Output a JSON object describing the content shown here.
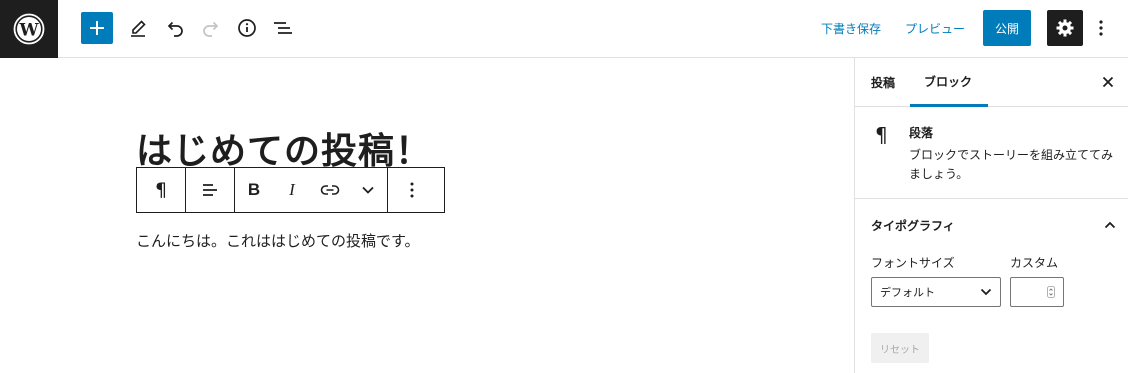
{
  "topbar": {
    "save_draft": "下書き保存",
    "preview": "プレビュー",
    "publish": "公開"
  },
  "editor": {
    "title": "はじめての投稿！",
    "paragraph": "こんにちは。これははじめての投稿です。"
  },
  "block_toolbar": {
    "paragraph_glyph": "¶",
    "bold_glyph": "B",
    "italic_glyph": "I"
  },
  "sidebar": {
    "tabs": [
      {
        "label": "投稿",
        "active": false
      },
      {
        "label": "ブロック",
        "active": true
      }
    ],
    "block_card": {
      "icon_glyph": "¶",
      "title": "段落",
      "description": "ブロックでストーリーを組み立ててみましょう。"
    },
    "typography": {
      "title": "タイポグラフィ",
      "font_size_label": "フォントサイズ",
      "font_size_value": "デフォルト",
      "custom_label": "カスタム",
      "reset_label": "リセット"
    }
  },
  "colors": {
    "accent": "#007cba",
    "dark": "#1e1e1e"
  }
}
